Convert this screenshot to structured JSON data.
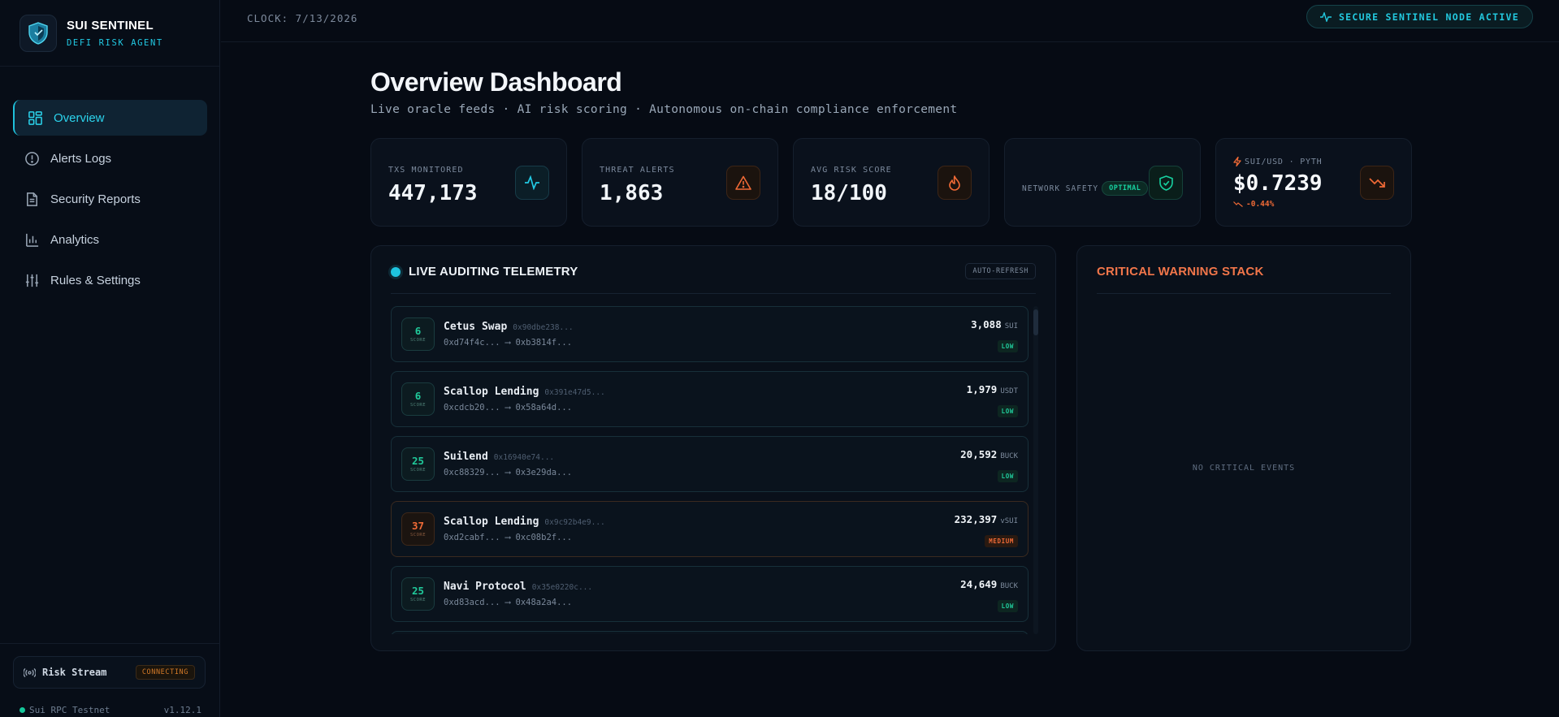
{
  "brand": {
    "title": "SUI SENTINEL",
    "subtitle": "DEFI RISK AGENT"
  },
  "nav": [
    {
      "label": "Overview",
      "icon": "grid-icon",
      "active": true
    },
    {
      "label": "Alerts Logs",
      "icon": "alert-circle-icon"
    },
    {
      "label": "Security Reports",
      "icon": "document-icon"
    },
    {
      "label": "Analytics",
      "icon": "bar-chart-icon"
    },
    {
      "label": "Rules & Settings",
      "icon": "sliders-icon"
    }
  ],
  "stream": {
    "label": "Risk Stream",
    "status": "CONNECTING"
  },
  "rpc": {
    "network": "Sui RPC Testnet",
    "version": "v1.12.1"
  },
  "topbar": {
    "clock": "CLOCK: 7/13/2026",
    "node_status": "SECURE SENTINEL NODE ACTIVE"
  },
  "header": {
    "title": "Overview Dashboard",
    "subtitle": "Live oracle feeds · AI risk scoring · Autonomous on-chain compliance enforcement"
  },
  "stats": {
    "txs": {
      "label": "TXS MONITORED",
      "value": "447,173"
    },
    "alerts": {
      "label": "THREAT ALERTS",
      "value": "1,863"
    },
    "risk": {
      "label": "AVG RISK SCORE",
      "value": "18/100"
    },
    "network": {
      "label": "NETWORK SAFETY",
      "badge": "OPTIMAL"
    },
    "price": {
      "label": "SUI/USD · PYTH",
      "value": "$0.7239",
      "change": "-0.44%"
    }
  },
  "telemetry": {
    "title": "LIVE AUDITING TELEMETRY",
    "refresh": "AUTO-REFRESH",
    "score_label": "SCORE",
    "rows": [
      {
        "score": "6",
        "protocol": "Cetus Swap",
        "hash": "0x90dbe238...",
        "from": "0xd74f4c...",
        "to": "0xb3814f...",
        "amount": "3,088",
        "token": "SUI",
        "risk": "LOW"
      },
      {
        "score": "6",
        "protocol": "Scallop Lending",
        "hash": "0x391e47d5...",
        "from": "0xcdcb20...",
        "to": "0x58a64d...",
        "amount": "1,979",
        "token": "USDT",
        "risk": "LOW"
      },
      {
        "score": "25",
        "protocol": "Suilend",
        "hash": "0x16940e74...",
        "from": "0xc88329...",
        "to": "0x3e29da...",
        "amount": "20,592",
        "token": "BUCK",
        "risk": "LOW"
      },
      {
        "score": "37",
        "protocol": "Scallop Lending",
        "hash": "0x9c92b4e9...",
        "from": "0xd2cabf...",
        "to": "0xc08b2f...",
        "amount": "232,397",
        "token": "vSUI",
        "risk": "MEDIUM"
      },
      {
        "score": "25",
        "protocol": "Navi Protocol",
        "hash": "0x35e0220c...",
        "from": "0xd83acd...",
        "to": "0x48a2a4...",
        "amount": "24,649",
        "token": "BUCK",
        "risk": "LOW"
      },
      {
        "score": "",
        "protocol": "",
        "hash": "",
        "from": "",
        "to": "",
        "amount": "",
        "token": "",
        "risk": ""
      }
    ]
  },
  "critical": {
    "title": "CRITICAL WARNING STACK",
    "empty": "NO CRITICAL EVENTS"
  }
}
